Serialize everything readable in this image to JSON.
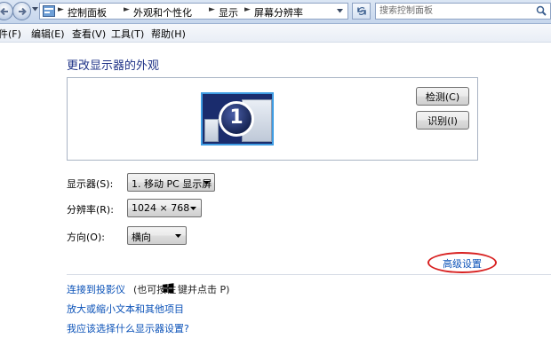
{
  "address_bar": {
    "breadcrumbs": [
      "控制面板",
      "外观和个性化",
      "显示",
      "屏幕分辨率"
    ]
  },
  "search": {
    "placeholder": "搜索控制面板"
  },
  "menu": [
    "件(F)",
    "编辑(E)",
    "查看(V)",
    "工具(T)",
    "帮助(H)"
  ],
  "main": {
    "title": "更改显示器的外观",
    "monitor_number": "1",
    "detect_button": "检测(C)",
    "identify_button": "识别(I)",
    "display_label": "显示器(S):",
    "display_value": "1. 移动 PC 显示屏",
    "resolution_label": "分辨率(R):",
    "resolution_value": "1024 × 768",
    "orientation_label": "方向(O):",
    "orientation_value": "横向",
    "advanced_link": "高级设置",
    "projector_link": "连接到投影仪",
    "projector_note_prefix": "(也可按住",
    "projector_note_suffix": "键并点击 P)",
    "enlarge_link": "放大或缩小文本和其他项目",
    "which_settings_link": "我应该选择什么显示器设置?"
  },
  "colors": {
    "link": "#0b52b8",
    "title": "#1e3287",
    "highlight_ring": "#d82121"
  },
  "icons": [
    "back-arrow-icon",
    "forward-arrow-icon",
    "control-panel-icon",
    "refresh-icon",
    "search-icon",
    "windows-logo-icon",
    "dropdown-arrow-icon"
  ]
}
